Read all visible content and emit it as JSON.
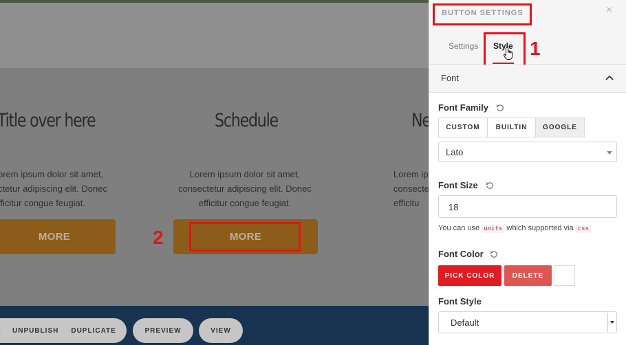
{
  "canvas": {
    "columns": [
      {
        "title": "Title over here",
        "text": [
          "orem ipsum dolor sit amet,",
          "ctetur adipiscing elit. Donec",
          "fficitur congue feugiat."
        ],
        "button": "MORE"
      },
      {
        "title": "Schedule",
        "text": [
          "Lorem ipsum dolor sit amet,",
          "consectetur adipiscing elit. Donec",
          "efficitur congue feugiat."
        ],
        "button": "MORE"
      },
      {
        "title": "Ne",
        "text": [
          "Lorem ip",
          "consectet",
          "efficitu"
        ],
        "button": ""
      }
    ],
    "toolbar": {
      "unpublish": "UNPUBLISH",
      "duplicate": "DUPLICATE",
      "preview": "PREVIEW",
      "view": "VIEW"
    },
    "annotations": {
      "one": "1",
      "two": "2"
    }
  },
  "panel": {
    "title": "BUTTON SETTINGS",
    "close": "×",
    "tabs": {
      "settings": "Settings",
      "style": "Style"
    },
    "section": "Font",
    "font_family": {
      "label": "Font Family",
      "options": [
        "CUSTOM",
        "BUILTIN",
        "GOOGLE"
      ],
      "selected_option": "GOOGLE",
      "value": "Lato"
    },
    "font_size": {
      "label": "Font Size",
      "value": "18",
      "help_prefix": "You can use",
      "help_code1": "units",
      "help_middle": "which supported via",
      "help_code2": "css"
    },
    "font_color": {
      "label": "Font Color",
      "pick": "PICK COLOR",
      "delete": "DELETE",
      "swatch_color": "#ffffff"
    },
    "font_style": {
      "label": "Font Style",
      "value": "Default"
    }
  },
  "colors": {
    "accent_red": "#e0151b",
    "more_button": "#8c5c1b",
    "footer": "#17334f"
  }
}
